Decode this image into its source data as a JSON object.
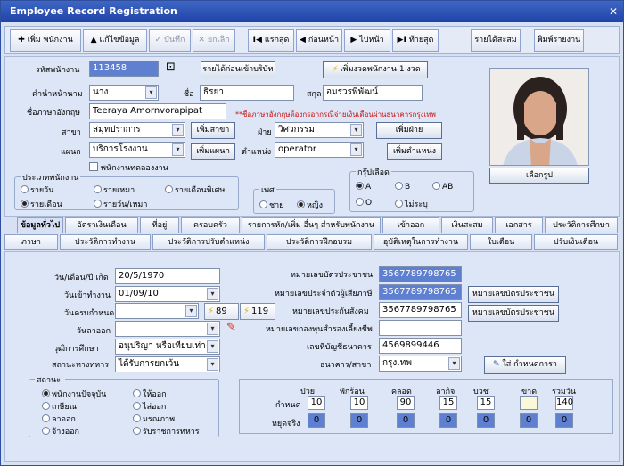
{
  "window": {
    "title": "Employee Record   Registration",
    "close": "✕"
  },
  "toolbar": [
    {
      "icon": "✚",
      "label": "เพิ่ม พนักงาน"
    },
    {
      "icon": "▲",
      "label": "แก้ไขข้อมูล"
    },
    {
      "icon": "✓",
      "label": "บันทึก"
    },
    {
      "icon": "✕",
      "label": "ยกเลิก"
    },
    {
      "icon": "I◀",
      "label": "แรกสุด"
    },
    {
      "icon": "◀",
      "label": "ก่อนหน้า"
    },
    {
      "icon": "▶",
      "label": "ไปหน้า"
    },
    {
      "icon": "▶I",
      "label": "ท้ายสุด"
    },
    {
      "icon": "",
      "label": "รายได้สะสม"
    },
    {
      "icon": "",
      "label": "พิมพ์รายงาน"
    }
  ],
  "employee": {
    "code_label": "รหัสพนักงาน",
    "code": "113458",
    "income_btn": "รายได้ก่อนเข้าบริษัท",
    "add_period_btn": "เพิ่มงวดพนักงาน 1 งวด",
    "prefix_label": "คำนำหน้านาม",
    "prefix": "นาง",
    "first_label": "ชื่อ",
    "first": "ธิรยา",
    "last_label": "สกุล",
    "last": "อมรวรพิพัฒน์",
    "en_label": "ชื่อภาษาอังกฤษ",
    "en": "Teeraya Amornvorapipat",
    "en_note": "**ชื่อภาษาอังกฤษต้องกรอกกรณีจ่ายเงินเดือนผ่านธนาคารกรุงเทพ",
    "branch_label": "สาขา",
    "branch": "สมุทปราการ",
    "branch_btn": "เพิ่มสาขา",
    "div_label": "ฝ่าย",
    "div": "วิศวกรรม",
    "div_btn": "เพิ่มฝ่าย",
    "dept_label": "แผนก",
    "dept": "บริการโรงงาน",
    "dept_btn": "เพิ่มแผนก",
    "pos_label": "ตำแหน่ง",
    "pos": "operator",
    "pos_btn": "เพิ่มตำแหน่ง",
    "probation": "พนักงานทดลองงาน",
    "photo_btn": "เลือกรูป"
  },
  "emp_type": {
    "title": "ประเภทพนักงาน",
    "options": [
      "รายวัน",
      "รายเหมา",
      "รายเดือนพิเศษ",
      "รายเดือน",
      "รายวัน/เหมา"
    ],
    "selected": "รายเดือน"
  },
  "sex": {
    "title": "เพศ",
    "options": [
      "ชาย",
      "หญิง"
    ],
    "selected": "หญิง"
  },
  "blood": {
    "title": "กรุ๊ปเลือด",
    "options": [
      "A",
      "B",
      "AB",
      "O",
      "ไม่ระบุ"
    ],
    "selected": "A"
  },
  "tabs_row1": [
    "ข้อมูลทั่วไป",
    "อัตราเงินเดือน",
    "ที่อยู่",
    "ครอบครัว",
    "รายการหัก/เพิ่ม อื่นๆ สำหรับพนักงาน",
    "เข้าออก",
    "เงินสะสม",
    "เอกสาร",
    "ประวัติการศึกษา"
  ],
  "tabs_row2": [
    "ภาษา",
    "ประวัติการทำงาน",
    "ประวัติการปรับตำแหน่ง",
    "ประวัติการฝึกอบรม",
    "อุบัติเหตุในการทำงาน",
    "ใบเตือน",
    "ปรับเงินเดือน"
  ],
  "active_tab": "ข้อมูลทั่วไป",
  "general": {
    "birth_label": "วัน/เดือน/ปี เกิด",
    "birth": "20/5/1970",
    "start_label": "วันเข้าทำงาน",
    "start": "01/09/10",
    "due_label": "วันครบกำหนด",
    "due": "",
    "d89": "89",
    "d119": "119",
    "leave_label": "วันลาออก",
    "leave": "",
    "edu_label": "วุฒิการศึกษา",
    "edu": "อนุปริญา หรือเทียบเท่า",
    "mil_label": "สถานะทางทหาร",
    "mil": "ได้รับการยกเว้น",
    "id_label": "หมายเลขบัตรประชาชน",
    "id": "3567789798765",
    "tax_label": "หมายเลขประจำตัวผู้เสียภาษี",
    "tax": "3567789798765",
    "ss_label": "หมายเลขประกันสังคม",
    "ss": "3567789798765",
    "pf_label": "หมายเลขกองทุนสำรองเลี้ยงชีพ",
    "pf": "",
    "acct_label": "เลขที่บัญชีธนาคาร",
    "acct": "4569899446",
    "bank_label": "ธนาคาร/สาขา",
    "bank": "กรุงเทพ",
    "btn_id1": "หมายเลขบัตรประชาชน",
    "btn_id2": "หมายเลขบัตรประชาชน",
    "btn_bank": "ใส่ กำหนดการา"
  },
  "status": {
    "title": "สถานะ:",
    "options": [
      "พนักงานปัจจุบัน",
      "ให้ออก",
      "เกษียณ",
      "ไล่ออก",
      "ลาออก",
      "มรณภาพ",
      "จ้างออก",
      "รับราชการทหาร"
    ],
    "selected": "พนักงานปัจจุบัน"
  },
  "leave_table": {
    "headers": [
      "ป่วย",
      "พักร้อน",
      "คลอด",
      "ลากิจ",
      "บวช",
      "ขาด",
      "รวมวัน"
    ],
    "row1_label": "กำหนด",
    "row1": [
      "10",
      "10",
      "90",
      "15",
      "15",
      "",
      "140"
    ],
    "row2_label": "หยุดจริง",
    "row2": [
      "0",
      "0",
      "0",
      "0",
      "0",
      "0",
      "0"
    ]
  }
}
